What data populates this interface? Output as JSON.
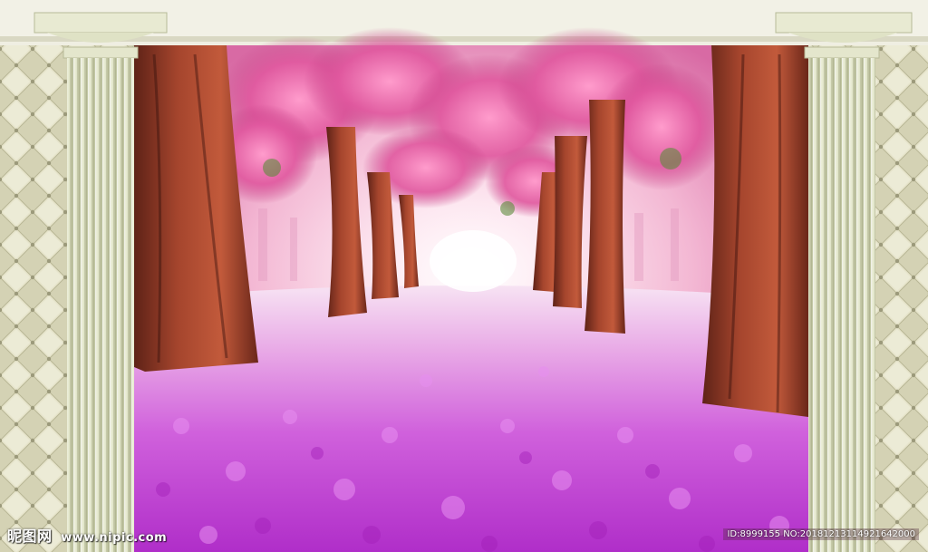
{
  "watermark": {
    "brand": "昵图网",
    "url": "www.nipic.com",
    "image_id": "ID:8999155 NO:20181213114921642000"
  },
  "colors": {
    "frame_cream": "#efeee2",
    "column": "#dfe3c6",
    "blossom_pink": "#e0579e",
    "petal_purple": "#c23ad6",
    "trunk": "#9a3d2a",
    "glow": "#fff4f8"
  },
  "elements": {
    "left_panel": "tufted-leather-panel",
    "right_panel": "tufted-leather-panel",
    "left_column": "ionic-column",
    "right_column": "ionic-column",
    "scene": "blossom-tree-avenue"
  }
}
